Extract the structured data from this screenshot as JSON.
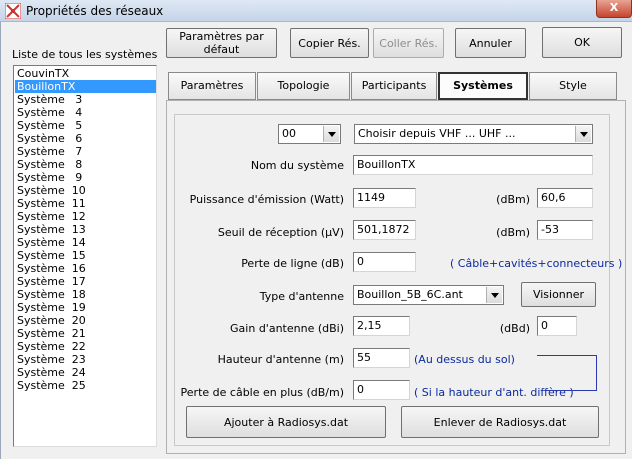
{
  "window": {
    "title": "Propriétés des réseaux",
    "close_glyph": "X"
  },
  "list": {
    "label": "Liste de tous les systèmes",
    "items": [
      "CouvinTX",
      "BouillonTX",
      "Système   3",
      "Système   4",
      "Système   5",
      "Système   6",
      "Système   7",
      "Système   8",
      "Système   9",
      "Système  10",
      "Système  11",
      "Système  12",
      "Système  13",
      "Système  14",
      "Système  15",
      "Système  16",
      "Système  17",
      "Système  18",
      "Système  19",
      "Système  20",
      "Système  21",
      "Système  22",
      "Système  23",
      "Système  24",
      "Système  25"
    ],
    "selected": 1
  },
  "toolbar": {
    "defaults": "Paramètres par défaut",
    "copy": "Copier Rés.",
    "paste": "Coller Rés.",
    "cancel": "Annuler",
    "ok": "OK"
  },
  "tabs": [
    "Paramètres",
    "Topologie",
    "Participants",
    "Systèmes",
    "Style"
  ],
  "active_tab": "Systèmes",
  "form": {
    "system_number": "00",
    "preset": "Choisir depuis VHF ... UHF ...",
    "name_label": "Nom du système",
    "name_value": "BouillonTX",
    "power_label": "Puissance d'émission (Watt)",
    "power_value": "1149",
    "dbm_label": "(dBm)",
    "power_dbm": "60,6",
    "threshold_label": "Seuil de réception (µV)",
    "threshold_value": "501,1872",
    "threshold_dbm": "-53",
    "line_loss_label": "Perte de ligne (dB)",
    "line_loss_value": "0",
    "line_loss_note": "( Câble+cavités+connecteurs )",
    "antenna_type_label": "Type d'antenne",
    "antenna_type_value": "Bouillon_5B_6C.ant",
    "view_button": "Visionner",
    "gain_label": "Gain d'antenne (dBi)",
    "gain_value": "2,15",
    "dbd_label": "(dBd)",
    "gain_dbd": "0",
    "height_label": "Hauteur d'antenne (m)",
    "height_value": "55",
    "height_note": "(Au dessus du sol)",
    "cable_loss_label": "Perte de câble en plus (dB/m)",
    "cable_loss_value": "0",
    "cable_loss_note": "( Si la hauteur d'ant. diffère )",
    "add_button": "Ajouter à Radiosys.dat",
    "remove_button": "Enlever de Radiosys.dat"
  },
  "colors": {
    "selection": "#3399ff",
    "note": "#0a2a9e"
  }
}
